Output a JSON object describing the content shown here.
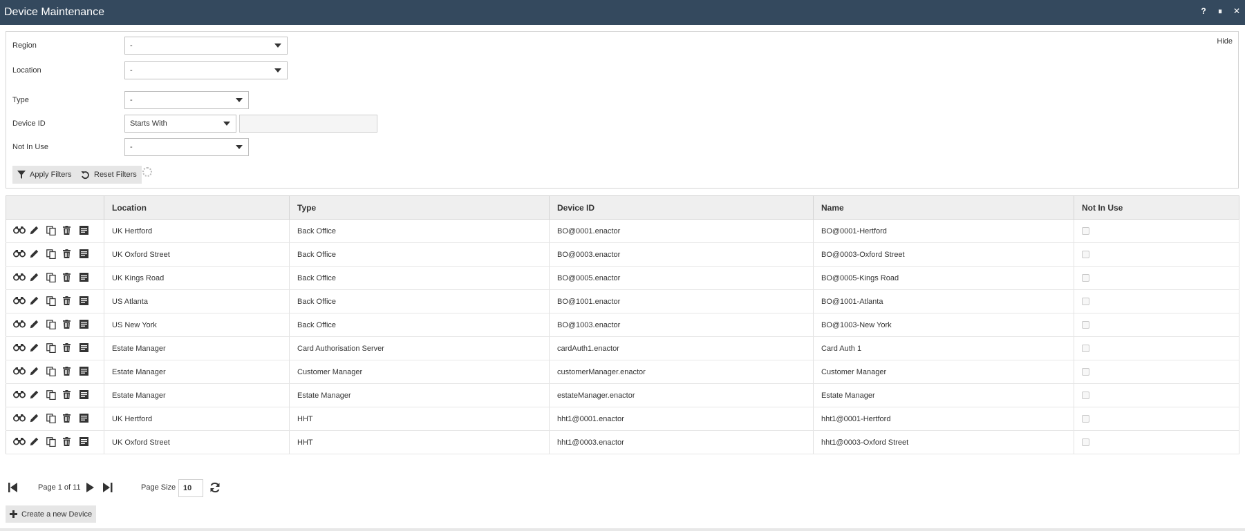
{
  "window": {
    "title": "Device Maintenance",
    "controls": [
      "?",
      "⏸",
      "✕"
    ]
  },
  "filters": {
    "hide_label": "Hide",
    "region": {
      "label": "Region",
      "value": "-"
    },
    "location": {
      "label": "Location",
      "value": "-"
    },
    "type": {
      "label": "Type",
      "value": "-"
    },
    "device_id": {
      "label": "Device ID",
      "operator": "Starts With",
      "value": ""
    },
    "not_in_use": {
      "label": "Not In Use",
      "value": "-"
    },
    "apply_label": "Apply Filters",
    "reset_label": "Reset Filters"
  },
  "table": {
    "columns": [
      "",
      "Location",
      "Type",
      "Device ID",
      "Name",
      "Not In Use"
    ],
    "row_actions": [
      "view-icon",
      "edit-icon",
      "copy-icon",
      "delete-icon",
      "details-icon"
    ],
    "rows": [
      {
        "location": "UK Hertford",
        "type": "Back Office",
        "device_id": "BO@0001.enactor",
        "name": "BO@0001-Hertford",
        "not_in_use": false
      },
      {
        "location": "UK Oxford Street",
        "type": "Back Office",
        "device_id": "BO@0003.enactor",
        "name": "BO@0003-Oxford Street",
        "not_in_use": false
      },
      {
        "location": "UK Kings Road",
        "type": "Back Office",
        "device_id": "BO@0005.enactor",
        "name": "BO@0005-Kings Road",
        "not_in_use": false
      },
      {
        "location": "US Atlanta",
        "type": "Back Office",
        "device_id": "BO@1001.enactor",
        "name": "BO@1001-Atlanta",
        "not_in_use": false
      },
      {
        "location": "US New York",
        "type": "Back Office",
        "device_id": "BO@1003.enactor",
        "name": "BO@1003-New York",
        "not_in_use": false
      },
      {
        "location": "Estate Manager",
        "type": "Card Authorisation Server",
        "device_id": "cardAuth1.enactor",
        "name": "Card Auth 1",
        "not_in_use": false
      },
      {
        "location": "Estate Manager",
        "type": "Customer Manager",
        "device_id": "customerManager.enactor",
        "name": "Customer Manager",
        "not_in_use": false
      },
      {
        "location": "Estate Manager",
        "type": "Estate Manager",
        "device_id": "estateManager.enactor",
        "name": "Estate Manager",
        "not_in_use": false
      },
      {
        "location": "UK Hertford",
        "type": "HHT",
        "device_id": "hht1@0001.enactor",
        "name": "hht1@0001-Hertford",
        "not_in_use": false
      },
      {
        "location": "UK Oxford Street",
        "type": "HHT",
        "device_id": "hht1@0003.enactor",
        "name": "hht1@0003-Oxford Street",
        "not_in_use": false
      }
    ]
  },
  "pager": {
    "page_text": "Page 1 of 11",
    "page_size_label": "Page Size",
    "page_size": "10"
  },
  "create_label": "Create a new Device",
  "colors": {
    "titlebar": "#34495e",
    "button_bg": "#e6e6e6",
    "header_bg": "#efefef"
  }
}
